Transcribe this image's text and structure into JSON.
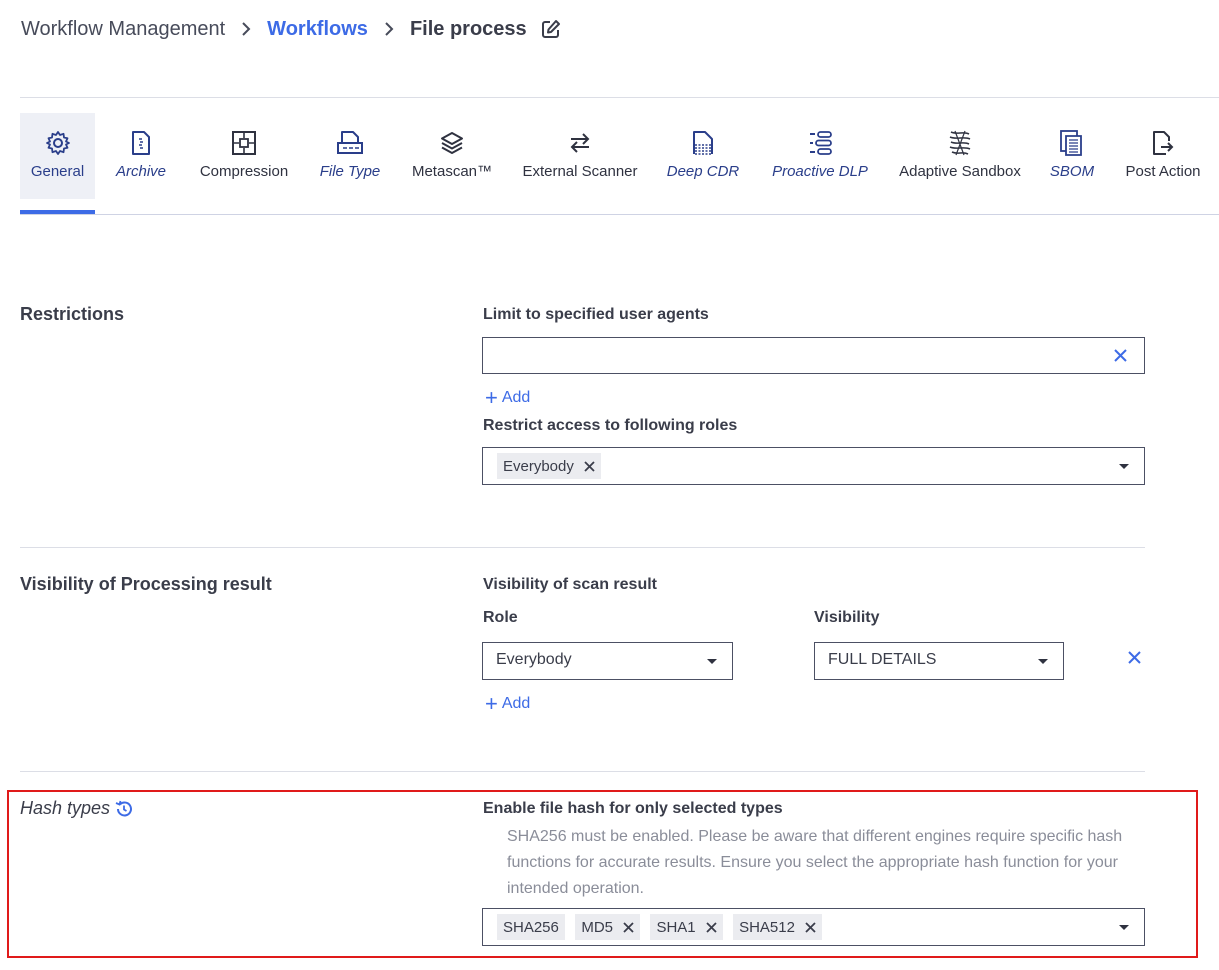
{
  "breadcrumb": {
    "root": "Workflow Management",
    "link": "Workflows",
    "current": "File process"
  },
  "tabs": [
    {
      "label": "General",
      "icon": "gear-icon"
    },
    {
      "label": "Archive",
      "icon": "archive-file-icon"
    },
    {
      "label": "Compression",
      "icon": "compression-icon"
    },
    {
      "label": "File Type",
      "icon": "file-type-icon"
    },
    {
      "label": "Metascan™",
      "icon": "layers-icon"
    },
    {
      "label": "External Scanner",
      "icon": "swap-arrows-icon"
    },
    {
      "label": "Deep CDR",
      "icon": "deep-cdr-icon"
    },
    {
      "label": "Proactive DLP",
      "icon": "dlp-icon"
    },
    {
      "label": "Adaptive Sandbox",
      "icon": "sandbox-icon"
    },
    {
      "label": "SBOM",
      "icon": "sbom-icon"
    },
    {
      "label": "Post Action",
      "icon": "post-action-icon"
    }
  ],
  "restrictions": {
    "title": "Restrictions",
    "user_agents_label": "Limit to specified user agents",
    "user_agents_value": "",
    "add_label": "Add",
    "roles_label": "Restrict access to following roles",
    "roles_chips": [
      "Everybody"
    ]
  },
  "visibility": {
    "title": "Visibility of Processing result",
    "scan_result_label": "Visibility of scan result",
    "role_label": "Role",
    "visibility_label": "Visibility",
    "role_value": "Everybody",
    "visibility_value": "FULL DETAILS",
    "add_label": "Add"
  },
  "hash": {
    "title": "Hash types",
    "enable_label": "Enable file hash for only selected types",
    "help": "SHA256 must be enabled. Please be aware that different engines require specific hash functions for accurate results. Ensure you select the appropriate hash function for your intended operation.",
    "chips": [
      "SHA256",
      "MD5",
      "SHA1",
      "SHA512"
    ]
  },
  "colors": {
    "accent": "#3d6be6",
    "highlight": "#e01a1a",
    "italic_tab": "#2a3e8a"
  }
}
